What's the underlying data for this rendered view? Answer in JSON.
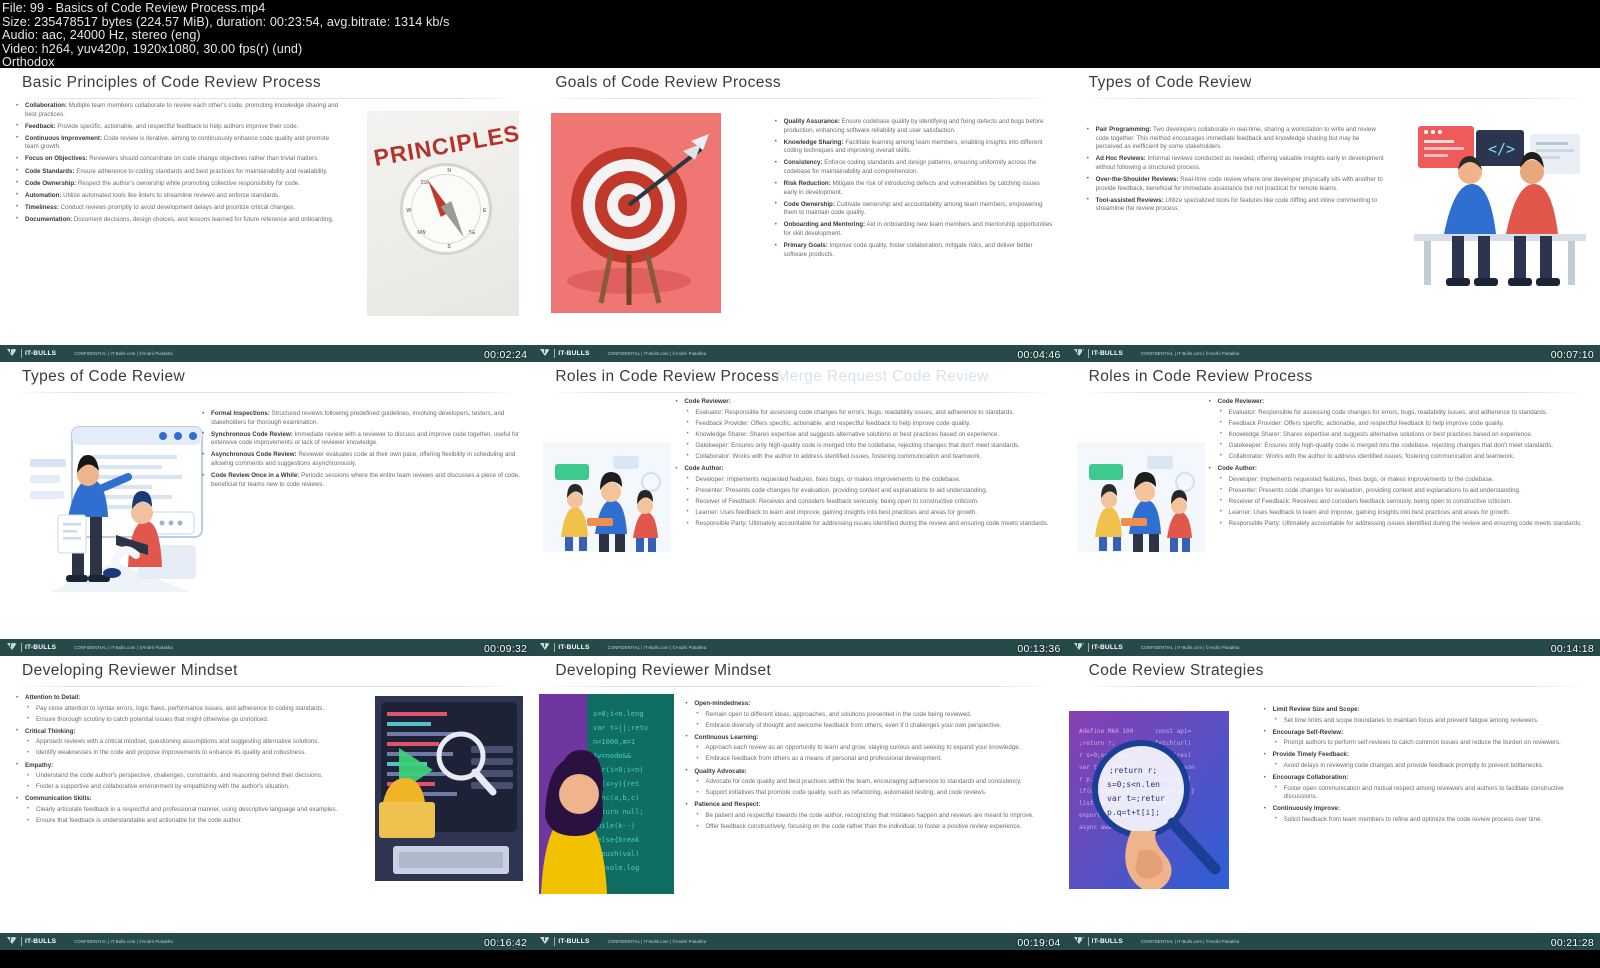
{
  "meta": {
    "line1": "File: 99 - Basics of Code Review Process.mp4",
    "line2": "Size: 235478517 bytes (224.57 MiB), duration: 00:23:54, avg.bitrate: 1314 kb/s",
    "line3": "Audio: aac, 24000 Hz, stereo (eng)",
    "line4": "Video: h264, yuv420p, 1920x1080, 30.00 fps(r) (und)",
    "line5": "Orthodox"
  },
  "footer": {
    "brand": "IT-BULLS",
    "confidential": "CONFIDENTIAL | IT-Bulls.com | ©Andrii Piatakha"
  },
  "slides": [
    {
      "title": "Basic Principles of Code Review Process",
      "timestamp": "00:02:24",
      "bullets": [
        {
          "term": "Collaboration:",
          "text": " Multiple team members collaborate to review each other's code, promoting knowledge sharing and best practices."
        },
        {
          "term": "Feedback:",
          "text": " Provide specific, actionable, and respectful feedback to help authors improve their code."
        },
        {
          "term": "Continuous Improvement:",
          "text": " Code review is iterative, aiming to continuously enhance code quality and promote team growth."
        },
        {
          "term": "Focus on Objectives:",
          "text": " Reviewers should concentrate on code change objectives rather than trivial matters."
        },
        {
          "term": "Code Standards:",
          "text": " Ensure adherence to coding standards and best practices for maintainability and readability."
        },
        {
          "term": "Code Ownership:",
          "text": " Respect the author's ownership while promoting collective responsibility for code."
        },
        {
          "term": "Automation:",
          "text": " Utilize automated tools like linters to streamline reviews and enforce standards."
        },
        {
          "term": "Timeliness:",
          "text": " Conduct reviews promptly to avoid development delays and prioritize critical changes."
        },
        {
          "term": "Documentation:",
          "text": " Document decisions, design choices, and lessons learned for future reference and onboarding."
        }
      ],
      "illustration": "compass-principles"
    },
    {
      "title": "Goals of Code Review Process",
      "timestamp": "00:04:46",
      "bullets": [
        {
          "term": "Quality Assurance:",
          "text": " Ensure codebase quality by identifying and fixing defects and bugs before production, enhancing software reliability and user satisfaction."
        },
        {
          "term": "Knowledge Sharing:",
          "text": " Facilitate learning among team members, enabling insights into different coding techniques and improving overall skills."
        },
        {
          "term": "Consistency:",
          "text": " Enforce coding standards and design patterns, ensuring uniformity across the codebase for maintainability and comprehension."
        },
        {
          "term": "Risk Reduction:",
          "text": " Mitigate the risk of introducing defects and vulnerabilities by catching issues early in development."
        },
        {
          "term": "Code Ownership:",
          "text": " Cultivate ownership and accountability among team members, empowering them to maintain code quality."
        },
        {
          "term": "Onboarding and Mentoring:",
          "text": " Aid in onboarding new team members and mentorship opportunities for skill development."
        },
        {
          "term": "Primary Goals:",
          "text": " Improve code quality, foster collaboration, mitigate risks, and deliver better software products."
        }
      ],
      "illustration": "target-arrow"
    },
    {
      "title": "Types of Code Review",
      "timestamp": "00:07:10",
      "bullets": [
        {
          "term": "Pair Programming:",
          "text": " Two developers collaborate in real-time, sharing a workstation to write and review code together. This method encourages immediate feedback and knowledge sharing but may be perceived as inefficient by some stakeholders."
        },
        {
          "term": "Ad Hoc Reviews:",
          "text": " Informal reviews conducted as needed, offering valuable insights early in development without following a structured process."
        },
        {
          "term": "Over-the-Shoulder Reviews:",
          "text": " Real-time code review where one developer physically sits with another to provide feedback, beneficial for immediate assistance but not practical for remote teams."
        },
        {
          "term": "Tool-assisted Reviews:",
          "text": " Utilize specialized tools for features like code diffing and inline commenting to streamline the review process."
        }
      ],
      "illustration": "pair-programming-desk"
    },
    {
      "title": "Types of Code Review",
      "timestamp": "00:09:32",
      "bullets": [
        {
          "term": "Formal Inspections:",
          "text": " Structured reviews following predefined guidelines, involving developers, testers, and stakeholders for thorough examination."
        },
        {
          "term": "Synchronous Code Review:",
          "text": " Immediate review with a reviewer to discuss and improve code together, useful for extensive code improvements or lack of reviewer knowledge."
        },
        {
          "term": "Asynchronous Code Review:",
          "text": " Reviewer evaluates code at their own pace, offering flexibility in scheduling and allowing comments and suggestions asynchronously."
        },
        {
          "term": "Code Review Once in a While:",
          "text": " Periodic sessions where the entire team reviews and discusses a piece of code, beneficial for teams new to code reviews."
        }
      ],
      "illustration": "whiteboard-review"
    },
    {
      "title": "Roles in Code Review Process",
      "ghost_title": "Merge Request Code Review",
      "timestamp": "00:13:36",
      "groups": [
        {
          "heading": "Code Reviewer:",
          "items": [
            "Evaluator: Responsible for assessing code changes for errors, bugs, readability issues, and adherence to standards.",
            "Feedback Provider: Offers specific, actionable, and respectful feedback to help improve code quality.",
            "Knowledge Sharer: Shares expertise and suggests alternative solutions or best practices based on experience.",
            "Gatekeeper: Ensures only high-quality code is merged into the codebase, rejecting changes that don't meet standards.",
            "Collaborator: Works with the author to address identified issues, fostering communication and teamwork."
          ]
        },
        {
          "heading": "Code Author:",
          "items": [
            "Developer: Implements requested features, fixes bugs, or makes improvements to the codebase.",
            "Presenter: Presents code changes for evaluation, providing context and explanations to aid understanding.",
            "Receiver of Feedback: Receives and considers feedback seriously, being open to constructive criticism.",
            "Learner: Uses feedback to learn and improve, gaining insights into best practices and areas for growth.",
            "Responsible Party: Ultimately accountable for addressing issues identified during the review and ensuring code meets standards."
          ]
        }
      ],
      "illustration": "team-collab"
    },
    {
      "title": "Roles in Code Review Process",
      "timestamp": "00:14:18",
      "groups": [
        {
          "heading": "Code Reviewer:",
          "items": [
            "Evaluator: Responsible for assessing code changes for errors, bugs, readability issues, and adherence to standards.",
            "Feedback Provider: Offers specific, actionable, and respectful feedback to help improve code quality.",
            "Knowledge Sharer: Shares expertise and suggests alternative solutions or best practices based on experience.",
            "Gatekeeper: Ensures only high-quality code is merged into the codebase, rejecting changes that don't meet standards.",
            "Collaborator: Works with the author to address identified issues, fostering communication and teamwork."
          ]
        },
        {
          "heading": "Code Author:",
          "items": [
            "Developer: Implements requested features, fixes bugs, or makes improvements to the codebase.",
            "Presenter: Presents code changes for evaluation, providing context and explanations to aid understanding.",
            "Receiver of Feedback: Receives and considers feedback seriously, being open to constructive criticism.",
            "Learner: Uses feedback to learn and improve, gaining insights into best practices and areas for growth.",
            "Responsible Party: Ultimately accountable for addressing issues identified during the review and ensuring code meets standards."
          ]
        }
      ],
      "illustration": "team-collab"
    },
    {
      "title": "Developing Reviewer Mindset",
      "timestamp": "00:16:42",
      "groups": [
        {
          "heading": "Attention to Detail:",
          "items": [
            "Pay close attention to syntax errors, logic flaws, performance issues, and adherence to coding standards.",
            "Ensure thorough scrutiny to catch potential issues that might otherwise go unnoticed."
          ]
        },
        {
          "heading": "Critical Thinking:",
          "items": [
            "Approach reviews with a critical mindset, questioning assumptions and suggesting alternative solutions.",
            "Identify weaknesses in the code and propose improvements to enhance its quality and robustness."
          ]
        },
        {
          "heading": "Empathy:",
          "items": [
            "Understand the code author's perspective, challenges, constraints, and reasoning behind their decisions.",
            "Foster a supportive and collaborative environment by empathizing with the author's situation."
          ]
        },
        {
          "heading": "Communication Skills:",
          "items": [
            "Clearly articulate feedback in a respectful and professional manner, using descriptive language and examples.",
            "Ensure that feedback is understandable and actionable for the code author."
          ]
        }
      ],
      "illustration": "code-debug-monitor"
    },
    {
      "title": "Developing Reviewer Mindset",
      "timestamp": "00:19:04",
      "groups": [
        {
          "heading": "Open-mindedness:",
          "items": [
            "Remain open to different ideas, approaches, and solutions presented in the code being reviewed.",
            "Embrace diversity of thought and welcome feedback from others, even if it challenges your own perspective."
          ]
        },
        {
          "heading": "Continuous Learning:",
          "items": [
            "Approach each review as an opportunity to learn and grow, staying curious and seeking to expand your knowledge.",
            "Embrace feedback from others as a means of personal and professional development."
          ]
        },
        {
          "heading": "Quality Advocate:",
          "items": [
            "Advocate for code quality and best practices within the team, encouraging adherence to standards and consistency.",
            "Support initiatives that promote code quality, such as refactoring, automated testing, and code reviews."
          ]
        },
        {
          "heading": "Patience and Respect:",
          "items": [
            "Be patient and respectful towards the code author, recognizing that mistakes happen and reviews are meant to improve.",
            "Offer feedback constructively, focusing on the code rather than the individual, to foster a positive review experience."
          ]
        }
      ],
      "illustration": "programmer-at-screen"
    },
    {
      "title": "Code Review Strategies",
      "timestamp": "00:21:28",
      "groups": [
        {
          "heading": "Limit Review Size and Scope:",
          "items": [
            "Set time limits and scope boundaries to maintain focus and prevent fatigue among reviewers."
          ]
        },
        {
          "heading": "Encourage Self-Review:",
          "items": [
            "Prompt authors to perform self-reviews to catch common issues and reduce the burden on reviewers."
          ]
        },
        {
          "heading": "Provide Timely Feedback:",
          "items": [
            "Avoid delays in reviewing code changes and provide feedback promptly to prevent bottlenecks."
          ]
        },
        {
          "heading": "Encourage Collaboration:",
          "items": [
            "Foster open communication and mutual respect among reviewers and authors to facilitate constructive discussions."
          ]
        },
        {
          "heading": "Continuously Improve:",
          "items": [
            "Solicit feedback from team members to refine and optimize the code review process over time."
          ]
        }
      ],
      "illustration": "magnifier-code"
    }
  ],
  "colors": {
    "footer_bar": "#264a4a",
    "title_text": "#3b3b3b",
    "body_text": "#6d6d6d",
    "accent_red": "#c0392b",
    "accent_blue": "#2c5fd6"
  }
}
